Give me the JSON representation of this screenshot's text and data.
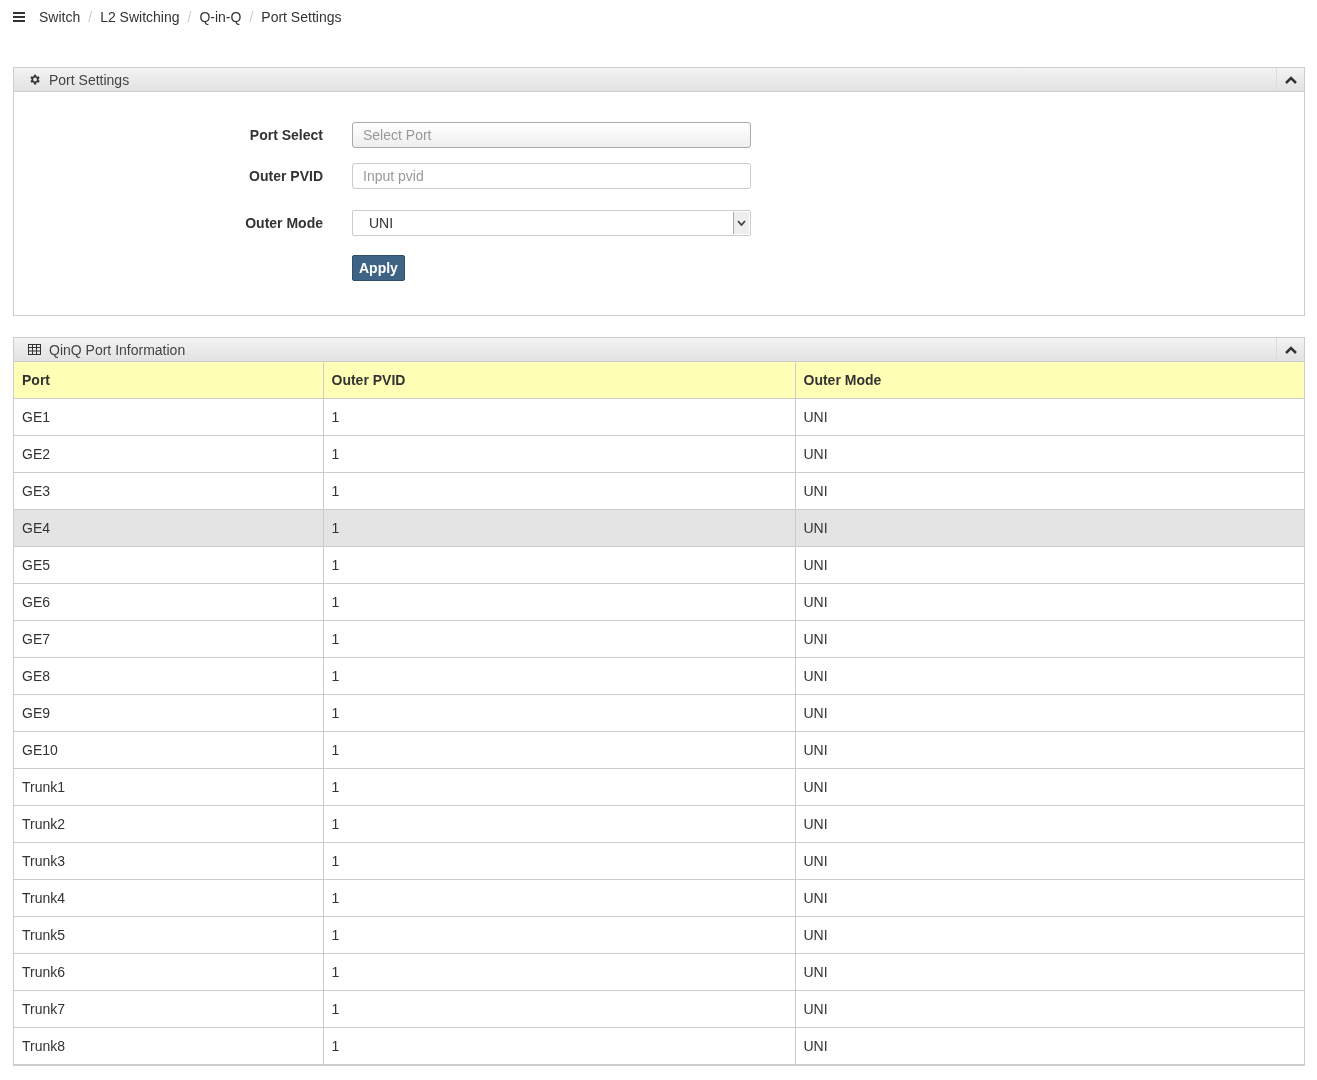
{
  "breadcrumb": [
    "Switch",
    "L2 Switching",
    "Q-in-Q",
    "Port Settings"
  ],
  "breadcrumb_separator": "/",
  "settings_panel": {
    "title": "Port Settings",
    "expanded": true,
    "fields": [
      {
        "kind": "select-input",
        "label": "Port Select",
        "placeholder": "Select Port"
      },
      {
        "kind": "text",
        "label": "Outer PVID",
        "placeholder": "Input pvid"
      },
      {
        "kind": "dropdown",
        "label": "Outer Mode",
        "value": "UNI"
      }
    ],
    "apply_button": "Apply"
  },
  "info_panel": {
    "title": "QinQ Port Information",
    "expanded": true,
    "columns": [
      "Port",
      "Outer PVID",
      "Outer Mode"
    ],
    "rows": [
      {
        "cells": [
          "GE1",
          "1",
          "UNI"
        ],
        "highlighted": false
      },
      {
        "cells": [
          "GE2",
          "1",
          "UNI"
        ],
        "highlighted": false
      },
      {
        "cells": [
          "GE3",
          "1",
          "UNI"
        ],
        "highlighted": false
      },
      {
        "cells": [
          "GE4",
          "1",
          "UNI"
        ],
        "highlighted": true
      },
      {
        "cells": [
          "GE5",
          "1",
          "UNI"
        ],
        "highlighted": false
      },
      {
        "cells": [
          "GE6",
          "1",
          "UNI"
        ],
        "highlighted": false
      },
      {
        "cells": [
          "GE7",
          "1",
          "UNI"
        ],
        "highlighted": false
      },
      {
        "cells": [
          "GE8",
          "1",
          "UNI"
        ],
        "highlighted": false
      },
      {
        "cells": [
          "GE9",
          "1",
          "UNI"
        ],
        "highlighted": false
      },
      {
        "cells": [
          "GE10",
          "1",
          "UNI"
        ],
        "highlighted": false
      },
      {
        "cells": [
          "Trunk1",
          "1",
          "UNI"
        ],
        "highlighted": false
      },
      {
        "cells": [
          "Trunk2",
          "1",
          "UNI"
        ],
        "highlighted": false
      },
      {
        "cells": [
          "Trunk3",
          "1",
          "UNI"
        ],
        "highlighted": false
      },
      {
        "cells": [
          "Trunk4",
          "1",
          "UNI"
        ],
        "highlighted": false
      },
      {
        "cells": [
          "Trunk5",
          "1",
          "UNI"
        ],
        "highlighted": false
      },
      {
        "cells": [
          "Trunk6",
          "1",
          "UNI"
        ],
        "highlighted": false
      },
      {
        "cells": [
          "Trunk7",
          "1",
          "UNI"
        ],
        "highlighted": false
      },
      {
        "cells": [
          "Trunk8",
          "1",
          "UNI"
        ],
        "highlighted": false
      }
    ]
  }
}
